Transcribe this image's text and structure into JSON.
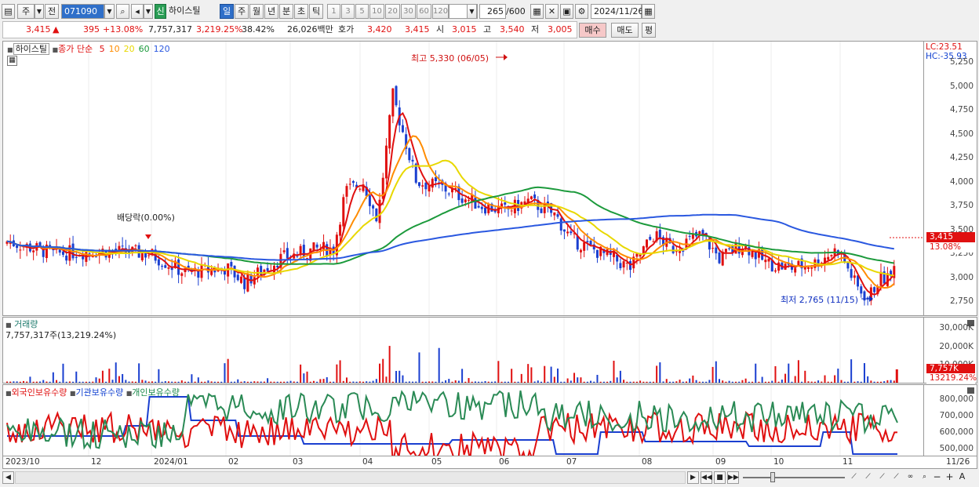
{
  "toolbar": {
    "market": "주",
    "prev": "전",
    "code": "071090",
    "new_badge": "신",
    "stock_name": "하이스틸",
    "periods": [
      "일",
      "주",
      "월",
      "년",
      "분",
      "초",
      "틱"
    ],
    "selected_period": "일",
    "nums": [
      "1",
      "3",
      "5",
      "10",
      "20",
      "30",
      "60",
      "120"
    ],
    "count": "265",
    "total": "/600",
    "date": "2024/11/26"
  },
  "info": {
    "price": "3,415",
    "change": "395",
    "change_pct": "+13.08%",
    "volume": "7,757,317",
    "volume_ratio": "3,219.25%",
    "turnover": "38.42%",
    "amount": "26,026백만",
    "bid_label": "호가",
    "ask": "3,420",
    "bid": "3,415",
    "open_label": "시",
    "open": "3,015",
    "high_label": "고",
    "high": "3,540",
    "low_label": "저",
    "low": "3,005",
    "buy": "매수",
    "sell": "매도",
    "avg": "평"
  },
  "price_panel": {
    "name": "하이스틸",
    "legend_prefix": "종가 단순",
    "ma": [
      {
        "p": "5",
        "c": "#e01010"
      },
      {
        "p": "10",
        "c": "#ff8c00"
      },
      {
        "p": "20",
        "c": "#e8d800"
      },
      {
        "p": "60",
        "c": "#1c9a3c"
      },
      {
        "p": "120",
        "c": "#2a58e0"
      }
    ],
    "lc": "LC:23.51",
    "hc": "HC:-35.93",
    "max_note": "최고 5,330 (06/05)",
    "min_note": "최저 2,765 (11/15)",
    "dividend_note": "배당락(0.00%)",
    "price_tag": "3,415",
    "pct_tag": "13.08%",
    "ticks": [
      "5,250",
      "5,000",
      "4,750",
      "4,500",
      "4,250",
      "4,000",
      "3,750",
      "3,500",
      "3,250",
      "3,000",
      "2,750"
    ]
  },
  "volume_panel": {
    "title": "거래량",
    "value": "7,757,317주(13,219.24%)",
    "ticks": [
      "30,000K",
      "20,000K",
      "10,000K"
    ],
    "vol_tag": "7,757K",
    "pct_tag": "13219.24%"
  },
  "holding_panel": {
    "foreign": "외국인보유수량",
    "inst": "기관보유수량",
    "indiv": "개인보유수량",
    "ticks": [
      "800,000",
      "700,000",
      "600,000",
      "500,000"
    ]
  },
  "dates": [
    "2023/10",
    "12",
    "2024/01",
    "02",
    "03",
    "04",
    "05",
    "06",
    "07",
    "08",
    "09",
    "10",
    "11",
    "11/26"
  ],
  "colors": {
    "up": "#e01010",
    "down": "#1a3fd0"
  }
}
